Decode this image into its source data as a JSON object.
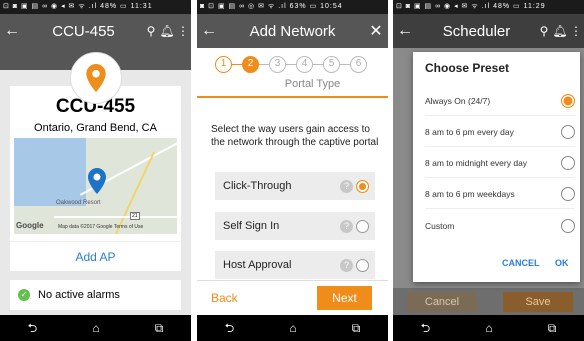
{
  "colors": {
    "accent": "#f08c1a",
    "link": "#2a7fd4",
    "appbar": "#565656"
  },
  "phone1": {
    "status": {
      "left": "⊡ ◙ ▣ ▤ ∞  ◉ ◂ ✉ ᯤ .ıl 48% ▭ 11:31"
    },
    "title": "CCU-455",
    "icons": [
      "back-arrow-icon",
      "search-icon",
      "bell-icon",
      "more-vert-icon",
      "location-pin-icon"
    ],
    "device_name": "CCU-455",
    "location": "Ontario, Grand Bend, CA",
    "map": {
      "poi": "Oakwood Resort",
      "road_label": "21",
      "google": "Google",
      "copyright": "Map data ©2017 Google   Terms of Use"
    },
    "add_ap": "Add AP",
    "alarm_text": "No active alarms"
  },
  "phone2": {
    "status": {
      "left": "◙ ⊡ ▣ ▤ ∞    ◎ ✉ ᯤ .ıl 63% ▭ 10:54"
    },
    "title": "Add Network",
    "steps": [
      "1",
      "2",
      "3",
      "4",
      "5",
      "6"
    ],
    "current_step": 2,
    "step_title": "Portal Type",
    "description": "Select the way users gain access to the network through the captive portal",
    "options": [
      {
        "label": "Click-Through",
        "selected": true
      },
      {
        "label": "Self Sign In",
        "selected": false
      },
      {
        "label": "Host Approval",
        "selected": false
      }
    ],
    "back": "Back",
    "next": "Next"
  },
  "phone3": {
    "status": {
      "left": "⊡ ◙ ▣ ▤ ∞  ◉ ◂ ✉ ᯤ .ıl 48% ▭ 11:29"
    },
    "title": "Scheduler",
    "dialog_title": "Choose Preset",
    "presets": [
      {
        "label": "Always On (24/7)",
        "selected": true
      },
      {
        "label": "8 am to 6 pm every day",
        "selected": false
      },
      {
        "label": "8 am to midnight every day",
        "selected": false
      },
      {
        "label": "8 am to 6 pm weekdays",
        "selected": false
      },
      {
        "label": "Custom",
        "selected": false
      }
    ],
    "cancel": "CANCEL",
    "ok": "OK",
    "bg_cancel": "Cancel",
    "bg_save": "Save"
  },
  "navbar": {
    "back": "⮌",
    "home": "⌂",
    "recents": "⧉"
  }
}
